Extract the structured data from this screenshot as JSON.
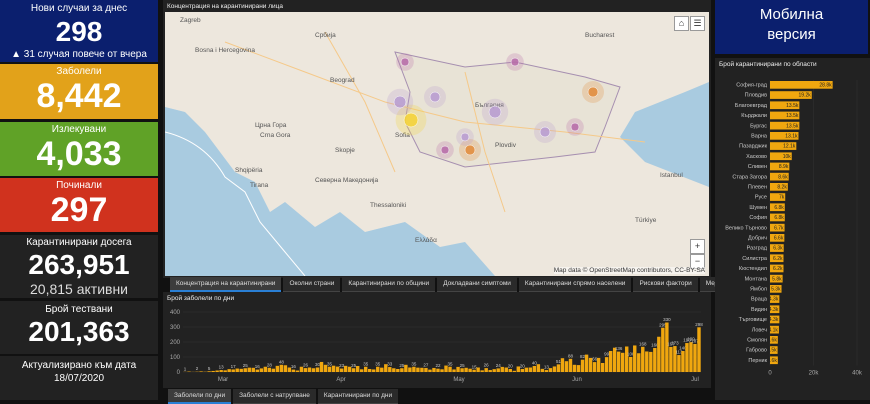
{
  "cards": {
    "new_cases": {
      "label": "Нови случаи за днес",
      "value": "298",
      "sub": "▲ 31 случая повече от вчера"
    },
    "infected": {
      "label": "Заболели",
      "value": "8,442"
    },
    "recovered": {
      "label": "Излекувани",
      "value": "4,033"
    },
    "deaths": {
      "label": "Починали",
      "value": "297"
    },
    "quarantined": {
      "label": "Карантинирани досега",
      "value": "263,951",
      "sub": "20,815 активни"
    },
    "tested": {
      "label": "Брой тествани",
      "value": "201,363"
    },
    "updated": {
      "label": "Актуализирано към дата",
      "date": "18/07/2020"
    }
  },
  "map": {
    "title": "Концентрация на карантинирани лица",
    "attribution": "Map data © OpenStreetMap contributors, CC-BY-SA",
    "zoom_in": "+",
    "zoom_out": "−",
    "home_icon": "home-icon",
    "list_icon": "list-icon",
    "labels": [
      "Bosna i Hercegovina",
      "Србија",
      "Црна Гора",
      "Crna Gora",
      "Shqipëria",
      "България",
      "Северна Македонија",
      "Ελλάδα",
      "Türkiye",
      "Sofia",
      "Plovdiv",
      "Zagreb",
      "Beograd",
      "Tirana",
      "Skopje",
      "Thessaloniki",
      "Istanbul",
      "Bucharest"
    ]
  },
  "map_tabs": [
    "Концентрация на карантинирани",
    "Околни страни",
    "Карантинирани по общини",
    "Докладвани симптоми",
    "Карантинирани спрямо населени",
    "Рискови фактори",
    "Медицински лица"
  ],
  "daily_chart_title": "Брой заболели по дни",
  "bottom_tabs": [
    "Заболели по дни",
    "Заболели с натрупване",
    "Карантинирани по дни"
  ],
  "mobile": {
    "line1": "Мобилна",
    "line2": "версия"
  },
  "regions_title": "Брой карантинирани по области",
  "colors": {
    "new": "#0b1f6e",
    "infected": "#e2a21a",
    "recovered": "#60a227",
    "deaths": "#d0321e",
    "bar": "#f0a70f"
  },
  "chart_data": [
    {
      "type": "bar",
      "title": "Брой заболели по дни",
      "x_ticks": [
        "Mar",
        "Apr",
        "May",
        "Jun",
        "Jul"
      ],
      "y_ticks": [
        0,
        100,
        200,
        300,
        400
      ],
      "ylim": [
        0,
        400
      ],
      "values": [
        1,
        3,
        1,
        2,
        4,
        2,
        5,
        7,
        10,
        13,
        11,
        19,
        17,
        23,
        21,
        25,
        29,
        28,
        16,
        24,
        35,
        28,
        22,
        41,
        48,
        45,
        30,
        16,
        10,
        35,
        26,
        30,
        25,
        30,
        67,
        48,
        35,
        42,
        36,
        23,
        41,
        35,
        25,
        40,
        18,
        35,
        20,
        17,
        35,
        29,
        52,
        33,
        25,
        20,
        25,
        48,
        30,
        35,
        29,
        28,
        27,
        16,
        27,
        22,
        18,
        43,
        35,
        17,
        34,
        25,
        28,
        22,
        15,
        30,
        11,
        26,
        13,
        19,
        24,
        34,
        30,
        20,
        8,
        37,
        20,
        29,
        30,
        40,
        52,
        21,
        13,
        26,
        37,
        51,
        92,
        72,
        88,
        48,
        46,
        82,
        116,
        94,
        66,
        94,
        60,
        99,
        140,
        162,
        136,
        128,
        170,
        100,
        177,
        125,
        168,
        137,
        134,
        160,
        235,
        295,
        330,
        167,
        173,
        113,
        140,
        193,
        199,
        187,
        298
      ]
    },
    {
      "type": "bar",
      "orientation": "horizontal",
      "title": "Брой карантинирани по области",
      "categories": [
        "София-град",
        "Пловдив",
        "Благоевград",
        "Кърджали",
        "Бургас",
        "Варна",
        "Пазарджик",
        "Хасково",
        "Сливен",
        "Стара Загора",
        "Плевен",
        "Русе",
        "Шумен",
        "София",
        "Велико Търново",
        "Добрич",
        "Разград",
        "Силистра",
        "Кюстендил",
        "Монтана",
        "Ямбол",
        "Враца",
        "Видин",
        "Търговище",
        "Ловеч",
        "Смолян",
        "Габрово",
        "Перник"
      ],
      "values": [
        28.8,
        19.2,
        13.5,
        13.5,
        13.5,
        13.1,
        12.1,
        10.0,
        8.9,
        8.6,
        8.2,
        7.0,
        6.8,
        6.8,
        6.7,
        6.6,
        6.3,
        6.2,
        6.2,
        5.8,
        5.3,
        4.3,
        4.3,
        4.3,
        4.1,
        3.6,
        3.5,
        3.6
      ],
      "labels": [
        "28.8k",
        "19.2k",
        "13.5k",
        "13.5k",
        "13.5k",
        "13.1k",
        "12.1k",
        "10k",
        "8.9k",
        "8.6k",
        "8.2k",
        "7k",
        "6.8k",
        "6.8k",
        "6.7k",
        "6.6k",
        "6.3k",
        "6.2k",
        "6.2k",
        "5.8k",
        "5.3k",
        "4.3k",
        "4.3k",
        "4.3k",
        "4.1k",
        "3.6k",
        "3.5k",
        "3.6k"
      ],
      "x_ticks": [
        "0",
        "20k",
        "40k"
      ],
      "xlim": [
        0,
        40
      ]
    }
  ]
}
